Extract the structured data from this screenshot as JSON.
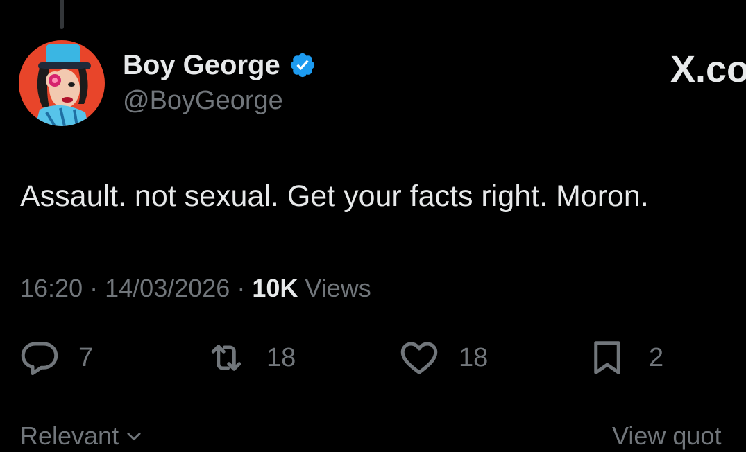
{
  "author": {
    "display_name": "Boy George",
    "handle": "@BoyGeorge",
    "verified": true,
    "verified_color": "#1d9bf0"
  },
  "watermark": "X.co",
  "tweet": {
    "text": "Assault. not sexual. Get your facts right. Moron.",
    "time": "16:20",
    "separator": "·",
    "date": "14/03/2026",
    "views_count": "10K",
    "views_label": "Views"
  },
  "actions": {
    "reply": {
      "icon": "reply-icon",
      "count": "7"
    },
    "retweet": {
      "icon": "retweet-icon",
      "count": "18"
    },
    "like": {
      "icon": "heart-icon",
      "count": "18"
    },
    "bookmark": {
      "icon": "bookmark-icon",
      "count": "2"
    }
  },
  "footer": {
    "sort_label": "Relevant",
    "view_quotes_label": "View quot"
  },
  "colors": {
    "background": "#000000",
    "primary_text": "#e7e9ea",
    "secondary_text": "#71767b",
    "accent": "#1d9bf0"
  }
}
